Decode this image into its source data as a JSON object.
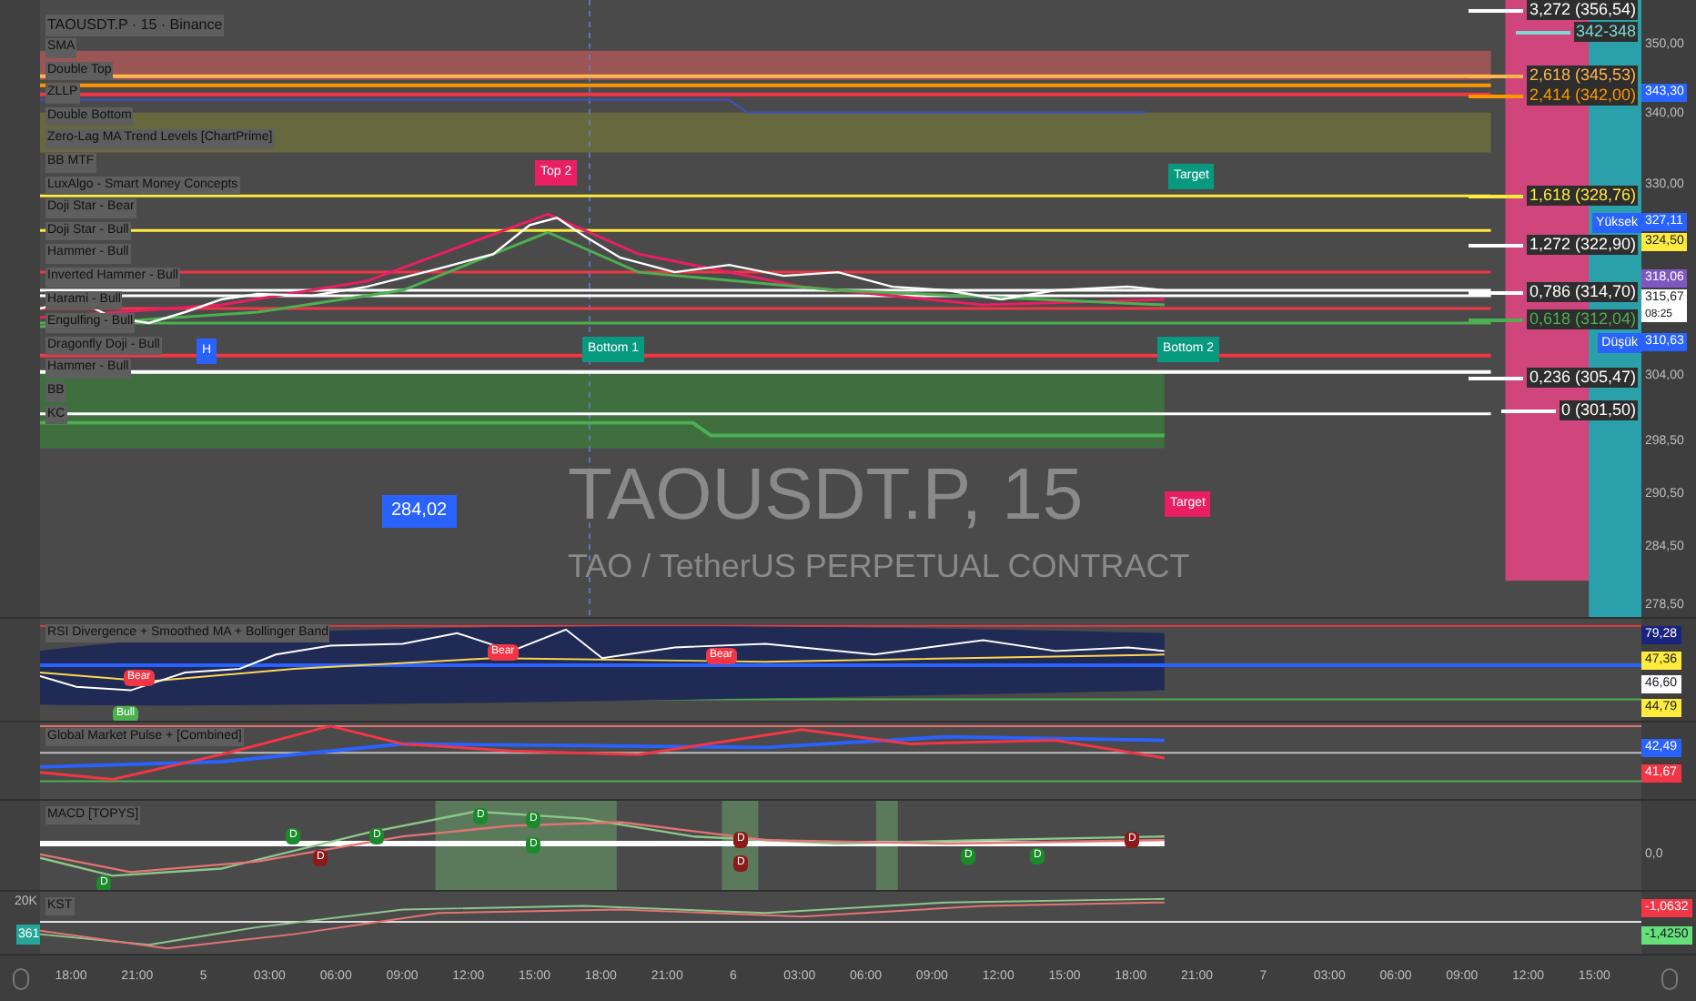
{
  "symbol_title": "TAOUSDT.P · 15 · Binance",
  "indicators": [
    "SMA",
    "Double Top",
    "ZLLP",
    "Double Bottom",
    "Zero-Lag MA Trend Levels [ChartPrime]",
    "BB MTF",
    "LuxAlgo - Smart Money Concepts",
    "Doji Star - Bear",
    "Doji Star - Bull",
    "Hammer - Bull",
    "Inverted Hammer - Bull",
    "Harami - Bull",
    "Engulfing - Bull",
    "Dragonfly Doji - Bull",
    "Hammer - Bull",
    "BB",
    "KC"
  ],
  "watermark": {
    "symbol": "TAOUSDT.P, 15",
    "description": "TAO / TetherUS PERPETUAL CONTRACT"
  },
  "chart_labels": [
    {
      "text": "Top 2",
      "color": "#e91e63"
    },
    {
      "text": "Target",
      "color": "#089981"
    },
    {
      "text": "Bottom 1",
      "color": "#089981"
    },
    {
      "text": "Bottom 2",
      "color": "#089981"
    },
    {
      "text": "Target",
      "color": "#e91e63"
    },
    {
      "text": "284,02",
      "color": "#2962ff"
    },
    {
      "text": "H",
      "color": "#2962ff"
    }
  ],
  "fib_levels": [
    {
      "text": "3,272 (356,54)",
      "color": "#ffffff"
    },
    {
      "text": "342-348",
      "color": "#7fd6d6"
    },
    {
      "text": "2,618 (345,53)",
      "color": "#ffb74d"
    },
    {
      "text": "2,414 (342,00)",
      "color": "#ff9800"
    },
    {
      "text": "1,618 (328,76)",
      "color": "#ffeb3b"
    },
    {
      "text": "1,272 (322,90)",
      "color": "#ffffff"
    },
    {
      "text": "0,786 (314,70)",
      "color": "#ffffff"
    },
    {
      "text": "0,618 (312,04)",
      "color": "#4caf50"
    },
    {
      "text": "0,236 (305,47)",
      "color": "#ffffff"
    },
    {
      "text": "0 (301,50)",
      "color": "#ffffff"
    }
  ],
  "price_axis": {
    "ticks": [
      "350,00",
      "340,00",
      "330,00",
      "304,00",
      "298,50",
      "290,50",
      "284,50",
      "278,50"
    ],
    "tags": [
      {
        "text": "343,30",
        "color": "#2962ff"
      },
      {
        "label": "Yüksek",
        "text": "327,11",
        "color": "#2962ff"
      },
      {
        "text": "324,50",
        "color": "#ffeb3b"
      },
      {
        "text": "318,06",
        "color": "#7e57c2"
      },
      {
        "text": "315,67",
        "sub": "08:25",
        "color": "#ffffff"
      },
      {
        "label": "Düşük",
        "text": "310,63",
        "color": "#2962ff"
      }
    ]
  },
  "panes": [
    {
      "title": "RSI Divergence + Smoothed MA + Bollinger Band",
      "tags": [
        {
          "text": "79,28",
          "color": "#1a237e"
        },
        {
          "text": "47,36",
          "color": "#ffeb3b"
        },
        {
          "text": "46,60",
          "color": "#ffffff"
        },
        {
          "text": "44,79",
          "color": "#ffeb3b"
        }
      ],
      "markers": [
        {
          "text": "Bull",
          "color": "#4caf50"
        },
        {
          "text": "Bear",
          "color": "#f23645"
        },
        {
          "text": "Bear",
          "color": "#f23645"
        },
        {
          "text": "Bear",
          "color": "#f23645"
        }
      ]
    },
    {
      "title": "Global Market Pulse + [Combined]",
      "tags": [
        {
          "text": "42,49",
          "color": "#2962ff"
        },
        {
          "text": "41,67",
          "color": "#f23645"
        }
      ]
    },
    {
      "title": "MACD [TOPYS]",
      "tags": [
        {
          "text": "0,0"
        }
      ],
      "markers": [
        {
          "text": "D",
          "color": "#1b8a2a"
        },
        {
          "text": "D",
          "color": "#1b8a2a"
        },
        {
          "text": "D",
          "color": "#8b1a1a"
        },
        {
          "text": "D",
          "color": "#1b8a2a"
        },
        {
          "text": "D",
          "color": "#1b8a2a"
        },
        {
          "text": "D",
          "color": "#1b8a2a"
        },
        {
          "text": "D",
          "color": "#1b8a2a"
        },
        {
          "text": "D",
          "color": "#8b1a1a"
        },
        {
          "text": "D",
          "color": "#8b1a1a"
        },
        {
          "text": "D",
          "color": "#1b8a2a"
        },
        {
          "text": "D",
          "color": "#1b8a2a"
        },
        {
          "text": "D",
          "color": "#8b1a1a"
        }
      ]
    },
    {
      "title": "KST",
      "tags": [
        {
          "text": "-1,0632",
          "color": "#f23645"
        },
        {
          "text": "-1,4250",
          "color": "#66e07a"
        }
      ]
    }
  ],
  "volume": {
    "scale": "20K",
    "badge": "361"
  },
  "time_axis": [
    "18:00",
    "21:00",
    "5",
    "03:00",
    "06:00",
    "09:00",
    "12:00",
    "15:00",
    "18:00",
    "21:00",
    "6",
    "03:00",
    "06:00",
    "09:00",
    "12:00",
    "15:00",
    "18:00",
    "21:00",
    "7",
    "03:00",
    "06:00",
    "09:00",
    "12:00",
    "15:00"
  ]
}
